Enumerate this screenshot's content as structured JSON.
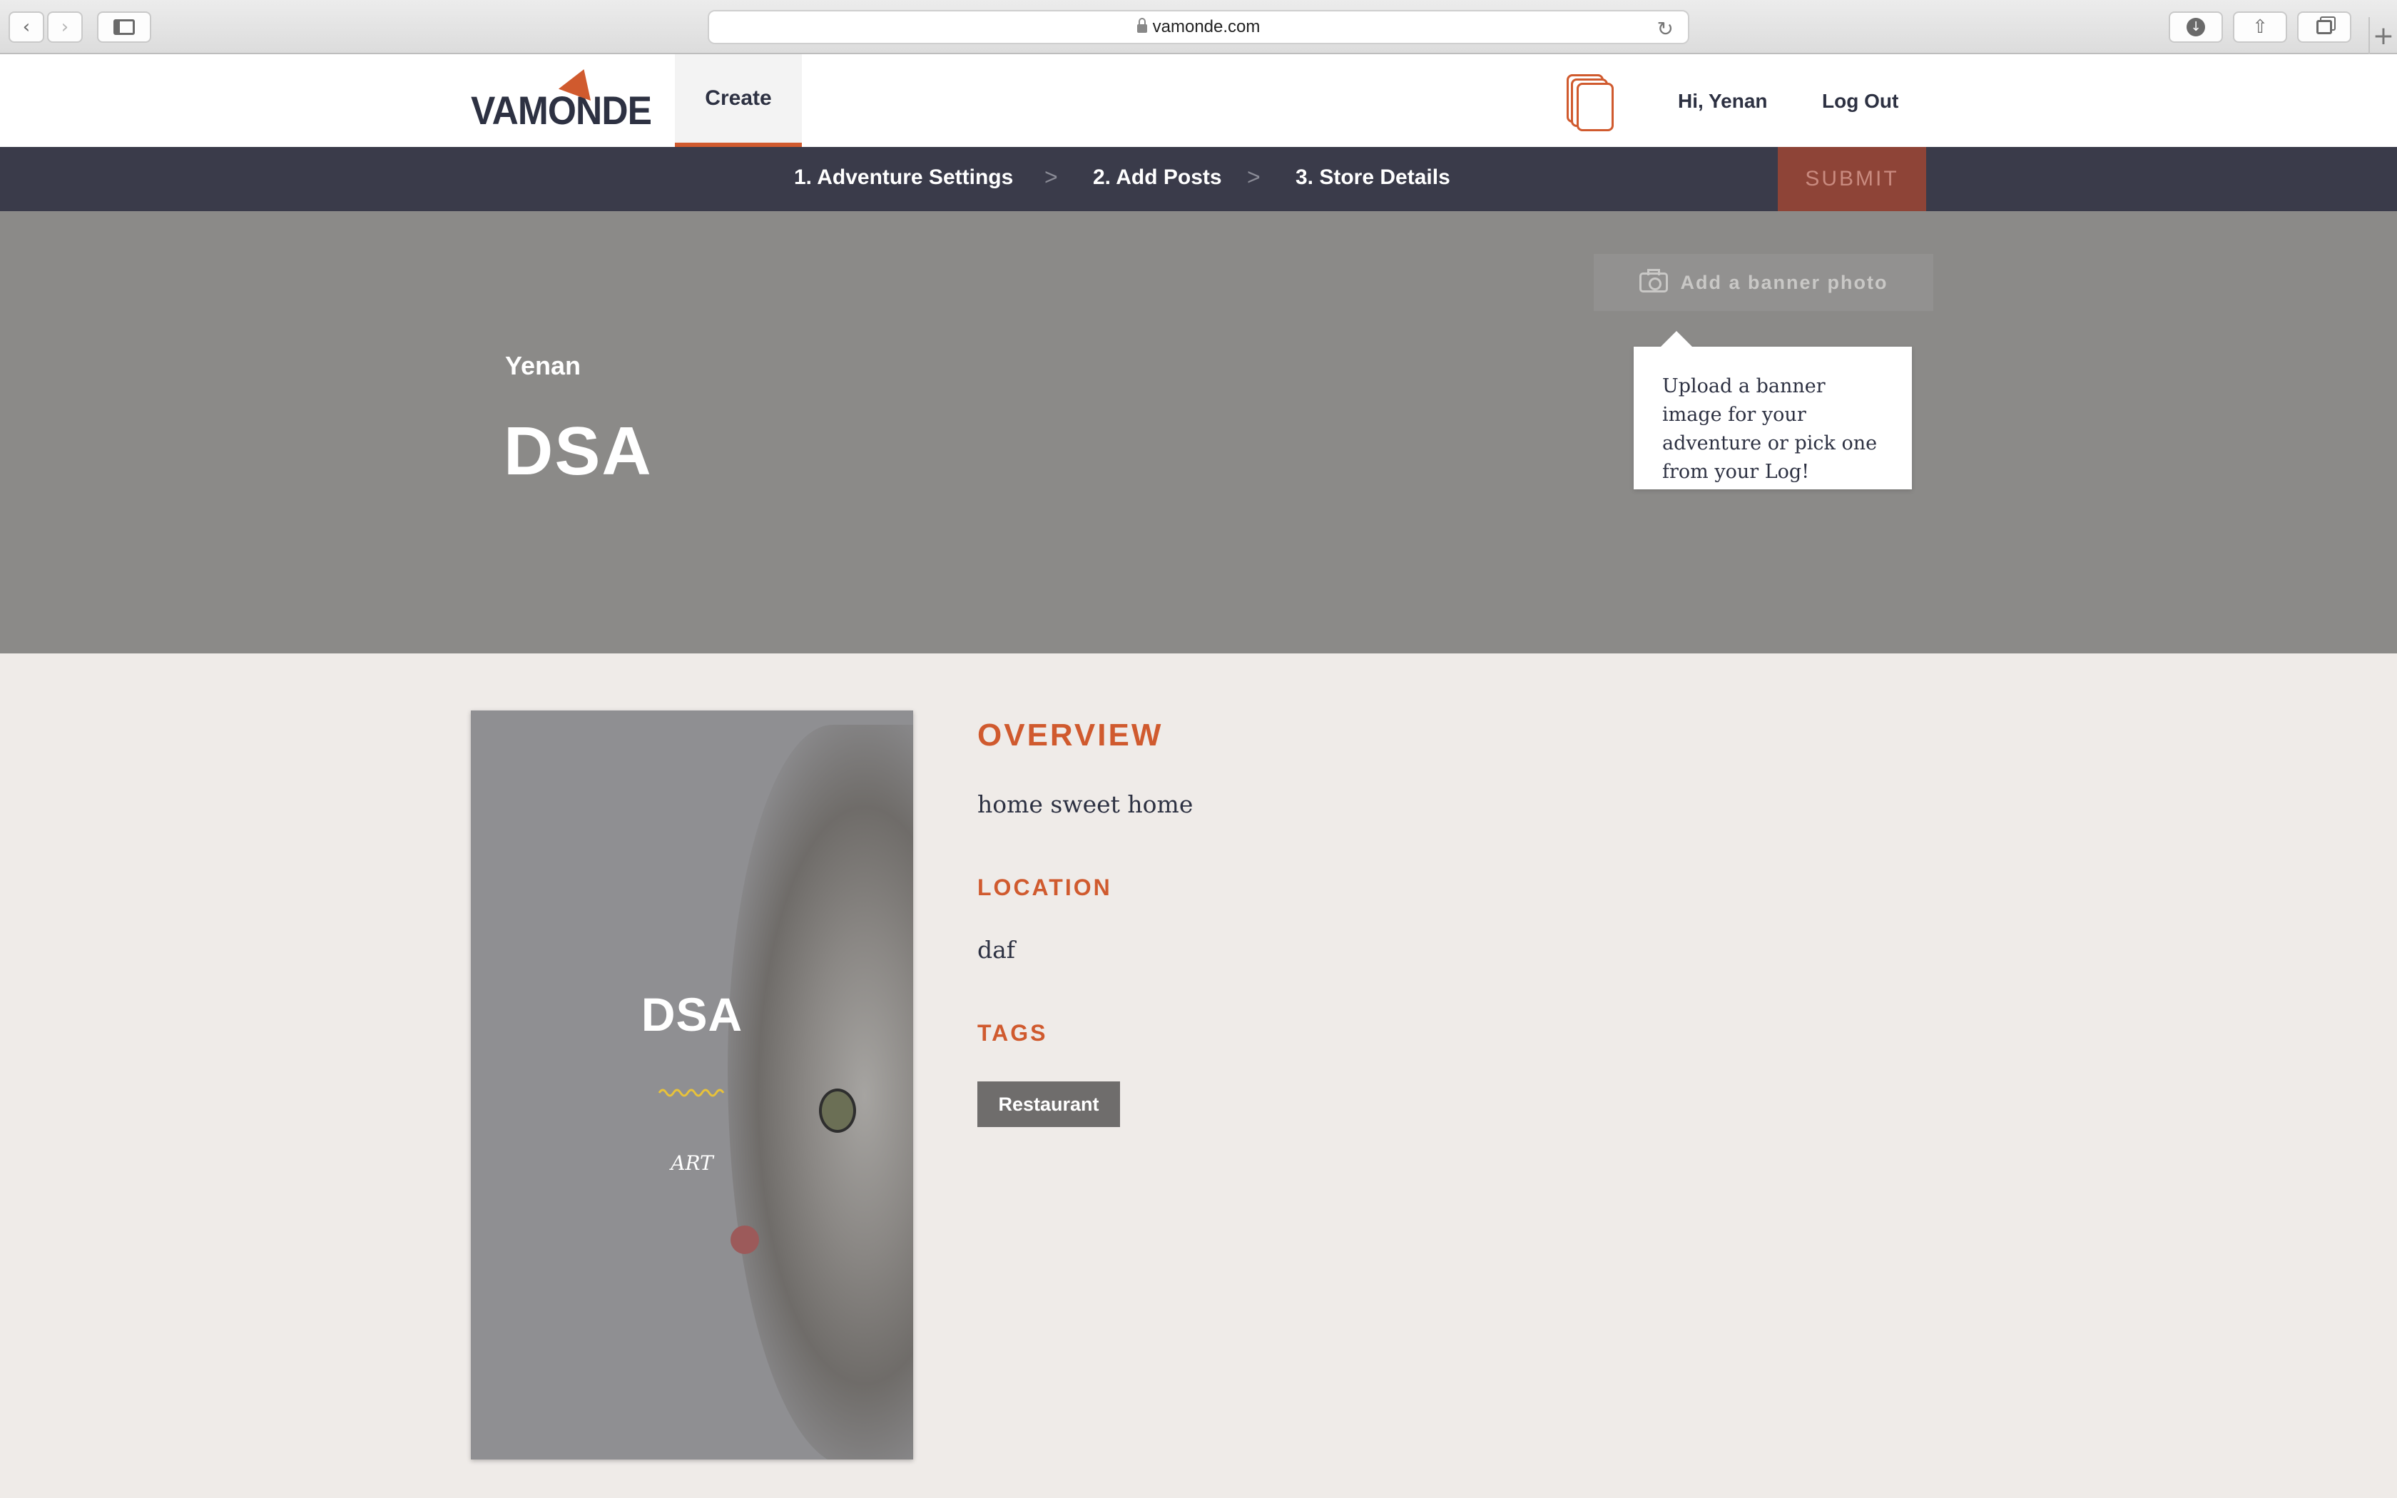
{
  "browser": {
    "url": "vamonde.com",
    "back_icon": "chevron-left-icon",
    "forward_icon": "chevron-right-icon",
    "sidebar_icon": "sidebar-icon",
    "reload_icon": "reload-icon",
    "download_icon": "download-icon",
    "share_icon": "share-icon",
    "tabs_icon": "tabs-icon",
    "new_tab_icon": "plus-icon"
  },
  "header": {
    "logo_text": "VAMONDE",
    "nav_create": "Create",
    "greeting": "Hi, Yenan",
    "logout": "Log Out",
    "accent_color": "#d05a2e"
  },
  "steps": {
    "items": [
      "1. Adventure Settings",
      "2. Add Posts",
      "3. Store Details"
    ],
    "separator": ">",
    "submit": "SUBMIT"
  },
  "banner": {
    "author": "Yenan",
    "title": "DSA",
    "add_photo": "Add a banner photo",
    "tooltip": "Upload a banner image for your adventure or pick one from your Log!"
  },
  "card": {
    "title": "DSA",
    "category": "ART"
  },
  "details": {
    "overview_label": "OVERVIEW",
    "overview_text": "home sweet home",
    "location_label": "LOCATION",
    "location_text": "daf",
    "tags_label": "TAGS",
    "tags": [
      "Restaurant"
    ]
  }
}
